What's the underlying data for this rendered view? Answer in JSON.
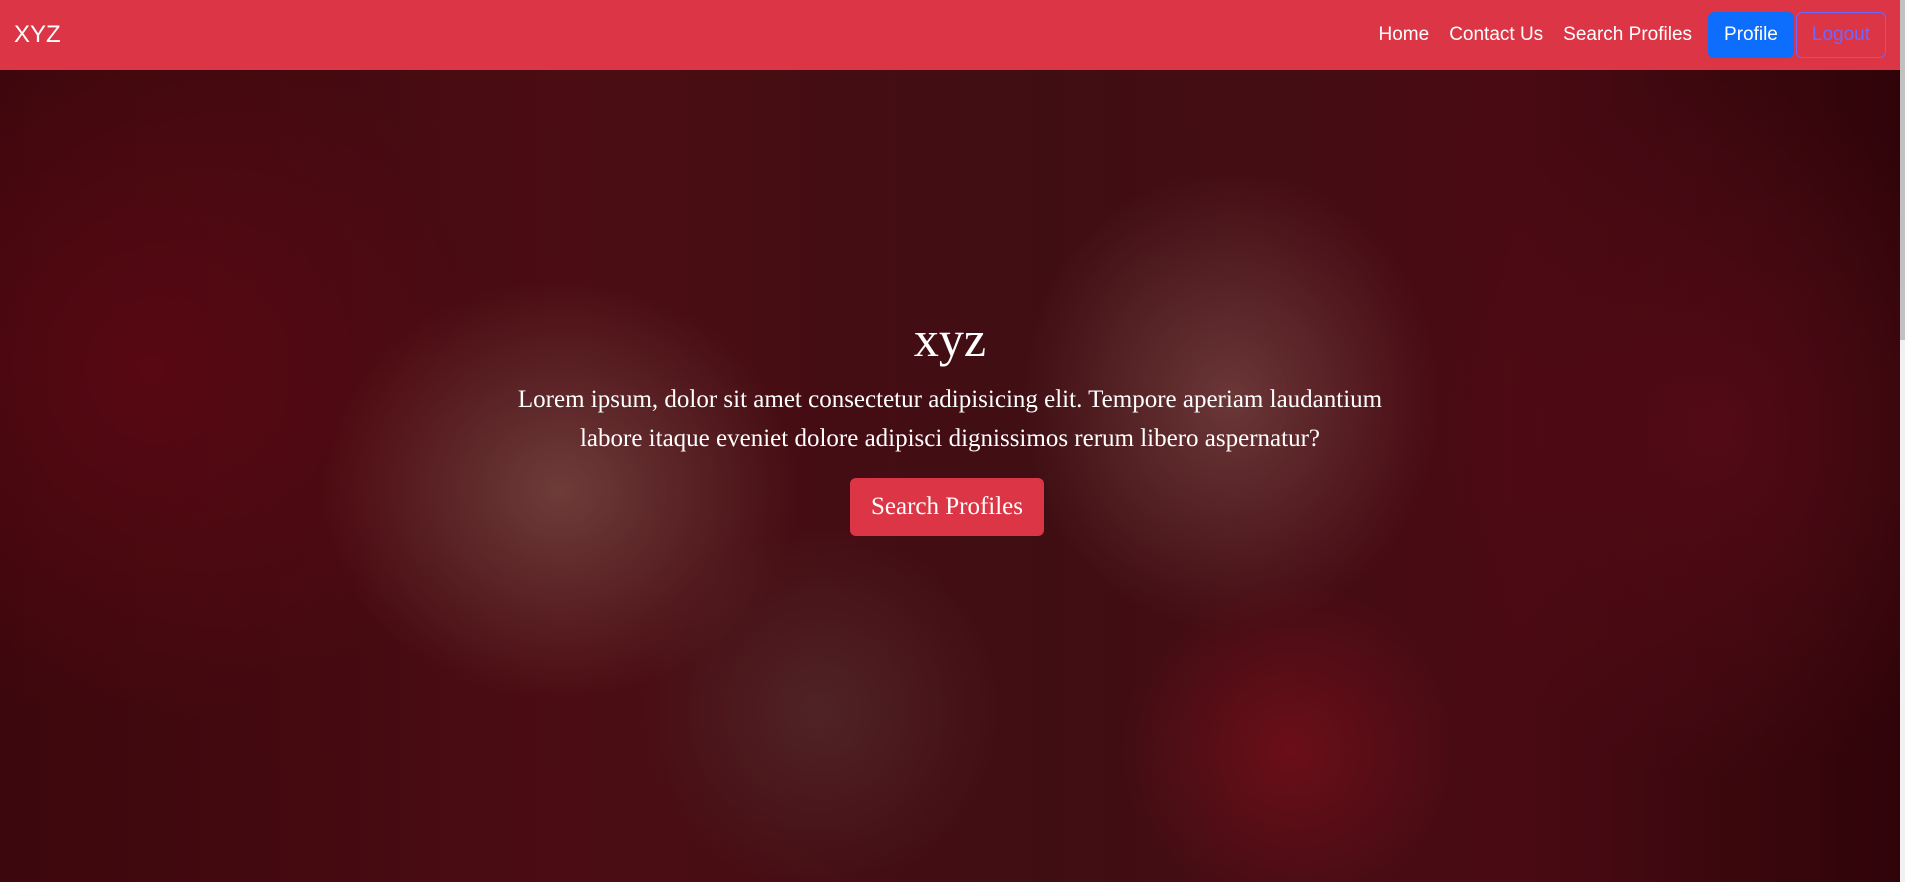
{
  "navbar": {
    "brand": "XYZ",
    "links": [
      "Home",
      "Contact Us",
      "Search Profiles"
    ],
    "profile_label": "Profile",
    "logout_label": "Logout",
    "colors": {
      "background": "#dc3545",
      "profile_button": "#0d6efd",
      "logout_outline": "#6f67ff"
    }
  },
  "hero": {
    "title": "xyz",
    "text": "Lorem ipsum, dolor sit amet consectetur adipisicing elit. Tempore aperiam laudantium labore itaque eveniet dolore adipisci dignissimos rerum libero aspernatur?",
    "button_label": "Search Profiles",
    "background_image": "photo-hands-pinky-promise-with-henna-rings-bangles"
  }
}
